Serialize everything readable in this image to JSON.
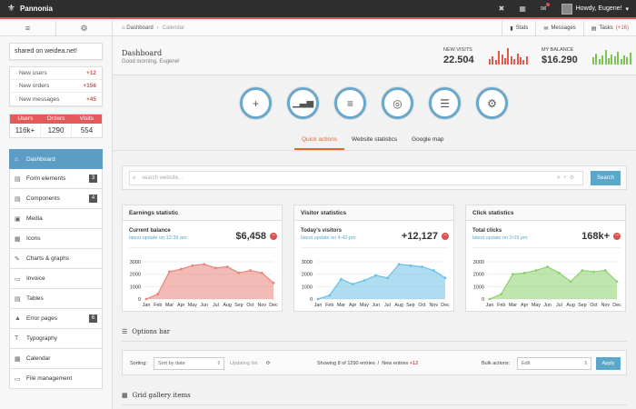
{
  "topbar": {
    "brand": "Pannonia",
    "greeting": "Howdy, Eugene!"
  },
  "sidebar": {
    "share_text": "shared on weidea.net!",
    "notifications": [
      {
        "label": "New users",
        "count": "+12"
      },
      {
        "label": "New orders",
        "count": "+156"
      },
      {
        "label": "New messages",
        "count": "+45"
      }
    ],
    "stats": {
      "headers": [
        "Users",
        "Orders",
        "Visits"
      ],
      "values": [
        "116k+",
        "1290",
        "554"
      ]
    },
    "nav": [
      {
        "label": "Dashboard",
        "icon": "home-icon",
        "badge": ""
      },
      {
        "label": "Form elements",
        "icon": "form-icon",
        "badge": "3"
      },
      {
        "label": "Components",
        "icon": "components-icon",
        "badge": "4"
      },
      {
        "label": "Media",
        "icon": "media-icon",
        "badge": ""
      },
      {
        "label": "Icons",
        "icon": "icons-icon",
        "badge": ""
      },
      {
        "label": "Charts & graphs",
        "icon": "charts-icon",
        "badge": ""
      },
      {
        "label": "Invoice",
        "icon": "invoice-icon",
        "badge": ""
      },
      {
        "label": "Tables",
        "icon": "tables-icon",
        "badge": ""
      },
      {
        "label": "Error pages",
        "icon": "warning-icon",
        "badge": "6"
      },
      {
        "label": "Typography",
        "icon": "typography-icon",
        "badge": ""
      },
      {
        "label": "Calendar",
        "icon": "calendar-icon",
        "badge": ""
      },
      {
        "label": "File management",
        "icon": "file-icon",
        "badge": ""
      }
    ]
  },
  "breadcrumb": {
    "home": "Dashboard",
    "current": "Calendar"
  },
  "toplinks": {
    "stats": "Stats",
    "messages": "Messages",
    "tasks": "Tasks",
    "tasks_count": "(+16)"
  },
  "header": {
    "title": "Dashboard",
    "subtitle": "Good morning, Eugene!",
    "visits_label": "NEW VISITS",
    "visits_value": "22.504",
    "balance_label": "MY BALANCE",
    "balance_value": "$16.290"
  },
  "quick_tabs": [
    "Quick actions",
    "Website statistics",
    "Google map"
  ],
  "search": {
    "placeholder": "search website...",
    "button": "Search"
  },
  "cards": [
    {
      "title": "Earnings statistic",
      "label": "Current balance",
      "update": "latest update on 12:39 am",
      "value": "$6,458"
    },
    {
      "title": "Visitor statistics",
      "label": "Today's visitors",
      "update": "latest update on 4:42 pm",
      "value": "+12,127"
    },
    {
      "title": "Click statistics",
      "label": "Total clicks",
      "update": "latest update on 3:09 pm",
      "value": "168k+"
    }
  ],
  "chart_data": [
    {
      "type": "area",
      "title": "Earnings statistic",
      "categories": [
        "Jan",
        "Feb",
        "Mar",
        "Apr",
        "May",
        "Jun",
        "Jul",
        "Aug",
        "Sep",
        "Oct",
        "Nov",
        "Dec"
      ],
      "values": [
        0,
        400,
        2200,
        2400,
        2700,
        2800,
        2500,
        2600,
        2100,
        2300,
        2100,
        1300
      ],
      "ylim": [
        0,
        3000
      ],
      "yticks": [
        "3000",
        "2000",
        "1000",
        "0"
      ],
      "color": "#e8847a"
    },
    {
      "type": "area",
      "title": "Visitor statistics",
      "categories": [
        "Jan",
        "Feb",
        "Mar",
        "Apr",
        "May",
        "Jun",
        "Jul",
        "Aug",
        "Sep",
        "Oct",
        "Nov",
        "Dec"
      ],
      "values": [
        0,
        300,
        1600,
        1200,
        1500,
        1900,
        1700,
        2800,
        2700,
        2600,
        2300,
        1700
      ],
      "ylim": [
        0,
        3000
      ],
      "yticks": [
        "3000",
        "2000",
        "1000",
        "0"
      ],
      "color": "#6cc0e6"
    },
    {
      "type": "area",
      "title": "Click statistics",
      "categories": [
        "Jan",
        "Feb",
        "Mar",
        "Apr",
        "May",
        "Jun",
        "Jul",
        "Aug",
        "Sep",
        "Oct",
        "Nov",
        "Dec"
      ],
      "values": [
        0,
        400,
        2000,
        2100,
        2300,
        2600,
        2100,
        1400,
        2300,
        2200,
        2300,
        1400
      ],
      "ylim": [
        0,
        3000
      ],
      "yticks": [
        "3000",
        "2000",
        "1000",
        "0"
      ],
      "color": "#8bd16c"
    }
  ],
  "options": {
    "section_title": "Options bar",
    "sorting_label": "Sorting:",
    "sorting_value": "Sort by date",
    "updating": "Updating list",
    "showing": "Showing 8 of 1290 entries",
    "new_entries_label": "New entries",
    "new_entries_value": "+12",
    "bulk_label": "Bulk actions:",
    "bulk_value": "Edit",
    "apply": "Apply"
  },
  "gallery": {
    "section_title": "Grid gallery items"
  }
}
